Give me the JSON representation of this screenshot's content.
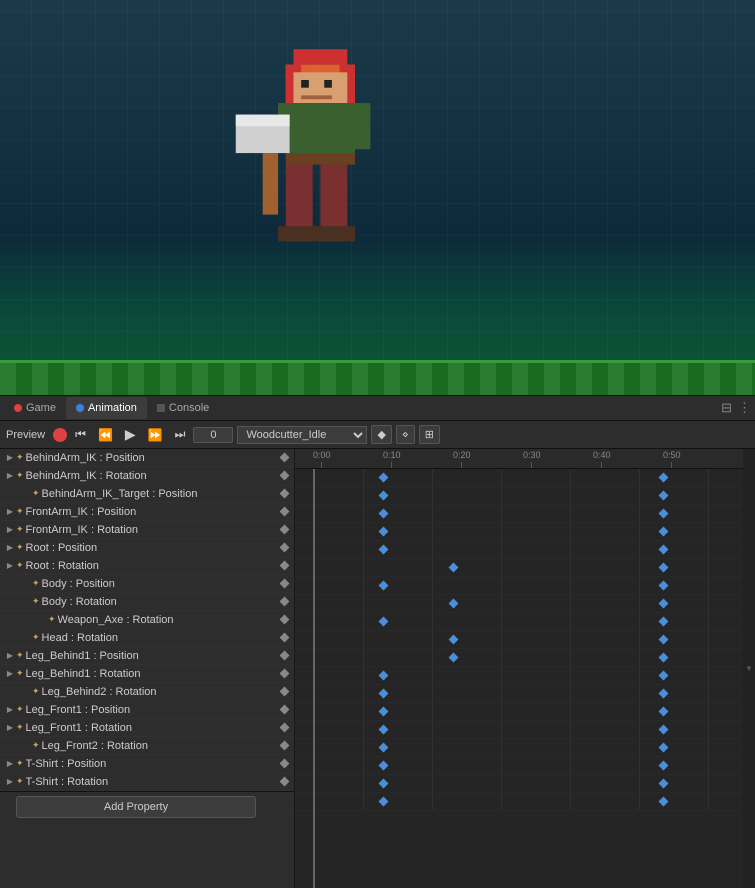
{
  "tabs": [
    {
      "id": "game",
      "label": "Game",
      "icon": "circle-red",
      "active": false
    },
    {
      "id": "animation",
      "label": "Animation",
      "icon": "circle-blue",
      "active": true
    },
    {
      "id": "console",
      "label": "Console",
      "icon": "square-gray",
      "active": false
    }
  ],
  "animation_controls": {
    "clip_name": "Woodcutter_Idle",
    "frame": "0",
    "buttons": [
      "record",
      "prev-start",
      "prev-frame",
      "play",
      "next-frame",
      "next-end"
    ]
  },
  "timeline": {
    "ruler_labels": [
      "0:00",
      "0:10",
      "0:20",
      "0:30",
      "0:40",
      "0:50"
    ],
    "ruler_positions": [
      18,
      88,
      158,
      228,
      298,
      368
    ]
  },
  "tree_items": [
    {
      "id": 1,
      "indent": 0,
      "has_arrow": true,
      "label": "BehindArm_IK : Position",
      "has_diamond": true,
      "keyframes": [
        88,
        368
      ]
    },
    {
      "id": 2,
      "indent": 0,
      "has_arrow": true,
      "label": "BehindArm_IK : Rotation",
      "has_diamond": true,
      "keyframes": [
        88,
        368
      ]
    },
    {
      "id": 3,
      "indent": 1,
      "has_arrow": false,
      "label": "BehindArm_IK_Target : Position",
      "has_diamond": true,
      "keyframes": [
        88,
        368
      ]
    },
    {
      "id": 4,
      "indent": 0,
      "has_arrow": true,
      "label": "FrontArm_IK : Position",
      "has_diamond": true,
      "keyframes": [
        88,
        368
      ]
    },
    {
      "id": 5,
      "indent": 0,
      "has_arrow": true,
      "label": "FrontArm_IK : Rotation",
      "has_diamond": true,
      "keyframes": [
        88,
        368
      ]
    },
    {
      "id": 6,
      "indent": 0,
      "has_arrow": true,
      "label": "Root : Position",
      "has_diamond": true,
      "keyframes": [
        158,
        368
      ]
    },
    {
      "id": 7,
      "indent": 0,
      "has_arrow": true,
      "label": "Root : Rotation",
      "has_diamond": true,
      "keyframes": [
        88,
        368
      ]
    },
    {
      "id": 8,
      "indent": 1,
      "has_arrow": false,
      "label": "Body : Position",
      "has_diamond": true,
      "keyframes": [
        158,
        368
      ]
    },
    {
      "id": 9,
      "indent": 1,
      "has_arrow": false,
      "label": "Body : Rotation",
      "has_diamond": true,
      "keyframes": [
        88,
        368
      ]
    },
    {
      "id": 10,
      "indent": 2,
      "has_arrow": false,
      "label": "Weapon_Axe : Rotation",
      "has_diamond": true,
      "keyframes": [
        158,
        368
      ]
    },
    {
      "id": 11,
      "indent": 1,
      "has_arrow": false,
      "label": "Head : Rotation",
      "has_diamond": true,
      "keyframes": [
        158,
        368
      ]
    },
    {
      "id": 12,
      "indent": 0,
      "has_arrow": true,
      "label": "Leg_Behind1 : Position",
      "has_diamond": true,
      "keyframes": [
        88,
        368
      ]
    },
    {
      "id": 13,
      "indent": 0,
      "has_arrow": true,
      "label": "Leg_Behind1 : Rotation",
      "has_diamond": true,
      "keyframes": [
        88,
        368
      ]
    },
    {
      "id": 14,
      "indent": 1,
      "has_arrow": false,
      "label": "Leg_Behind2 : Rotation",
      "has_diamond": true,
      "keyframes": [
        88,
        368
      ]
    },
    {
      "id": 15,
      "indent": 0,
      "has_arrow": true,
      "label": "Leg_Front1 : Position",
      "has_diamond": true,
      "keyframes": [
        88,
        368
      ]
    },
    {
      "id": 16,
      "indent": 0,
      "has_arrow": true,
      "label": "Leg_Front1 : Rotation",
      "has_diamond": true,
      "keyframes": [
        88,
        368
      ]
    },
    {
      "id": 17,
      "indent": 1,
      "has_arrow": false,
      "label": "Leg_Front2 : Rotation",
      "has_diamond": true,
      "keyframes": [
        88,
        368
      ]
    },
    {
      "id": 18,
      "indent": 0,
      "has_arrow": true,
      "label": "T-Shirt : Position",
      "has_diamond": true,
      "keyframes": [
        88,
        368
      ]
    },
    {
      "id": 19,
      "indent": 0,
      "has_arrow": true,
      "label": "T-Shirt : Rotation",
      "has_diamond": true,
      "keyframes": [
        88,
        368
      ]
    }
  ],
  "add_property_label": "Add Property"
}
